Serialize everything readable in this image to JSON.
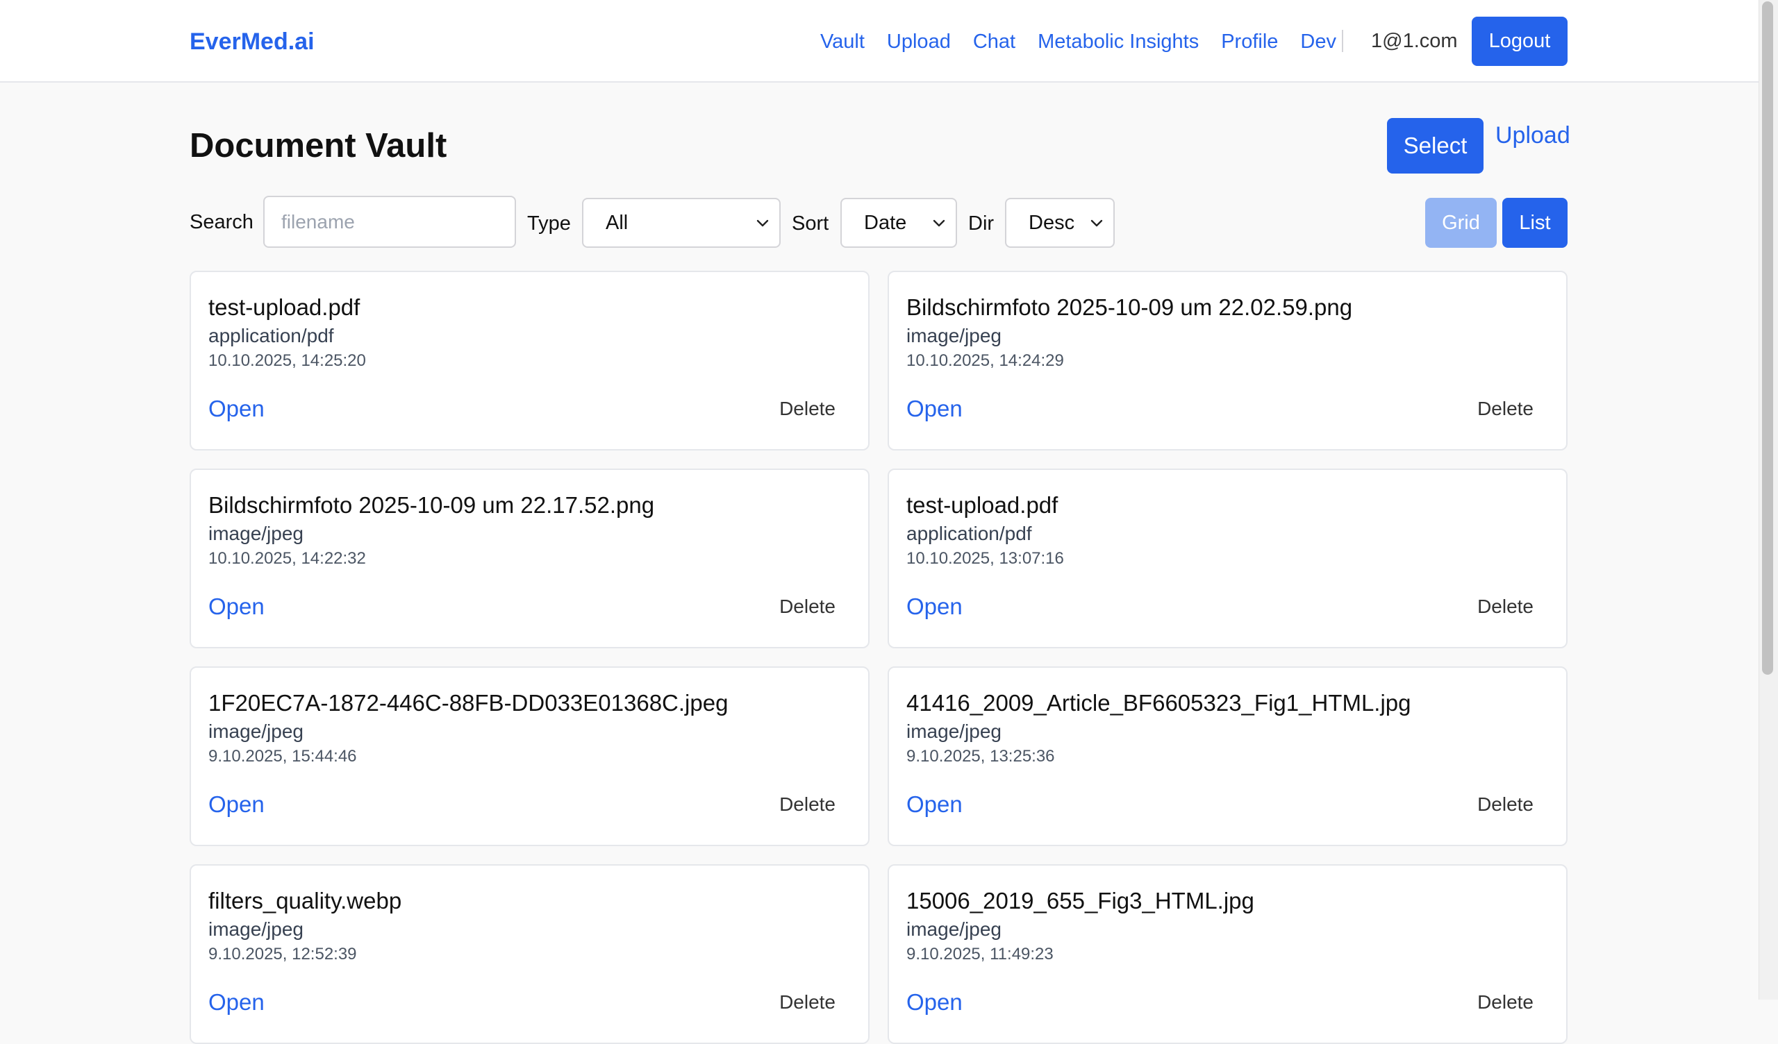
{
  "header": {
    "brand": "EverMed.ai",
    "nav": [
      "Vault",
      "Upload",
      "Chat",
      "Metabolic Insights",
      "Profile",
      "Dev"
    ],
    "user_email": "1@1.com",
    "logout_label": "Logout"
  },
  "page": {
    "title": "Document Vault",
    "select_label": "Select",
    "upload_label": "Upload"
  },
  "filters": {
    "search_label": "Search",
    "search_placeholder": "filename",
    "type_label": "Type",
    "type_value": "All",
    "sort_label": "Sort",
    "sort_value": "Date",
    "dir_label": "Dir",
    "dir_value": "Desc",
    "grid_label": "Grid",
    "list_label": "List"
  },
  "card_actions": {
    "open_label": "Open",
    "delete_label": "Delete"
  },
  "documents": [
    {
      "name": "test-upload.pdf",
      "type": "application/pdf",
      "date": "10.10.2025, 14:25:20"
    },
    {
      "name": "Bildschirmfoto 2025-10-09 um 22.02.59.png",
      "type": "image/jpeg",
      "date": "10.10.2025, 14:24:29"
    },
    {
      "name": "Bildschirmfoto 2025-10-09 um 22.17.52.png",
      "type": "image/jpeg",
      "date": "10.10.2025, 14:22:32"
    },
    {
      "name": "test-upload.pdf",
      "type": "application/pdf",
      "date": "10.10.2025, 13:07:16"
    },
    {
      "name": "1F20EC7A-1872-446C-88FB-DD033E01368C.jpeg",
      "type": "image/jpeg",
      "date": "9.10.2025, 15:44:46"
    },
    {
      "name": "41416_2009_Article_BF6605323_Fig1_HTML.jpg",
      "type": "image/jpeg",
      "date": "9.10.2025, 13:25:36"
    },
    {
      "name": "filters_quality.webp",
      "type": "image/jpeg",
      "date": "9.10.2025, 12:52:39"
    },
    {
      "name": "15006_2019_655_Fig3_HTML.jpg",
      "type": "image/jpeg",
      "date": "9.10.2025, 11:49:23"
    }
  ]
}
